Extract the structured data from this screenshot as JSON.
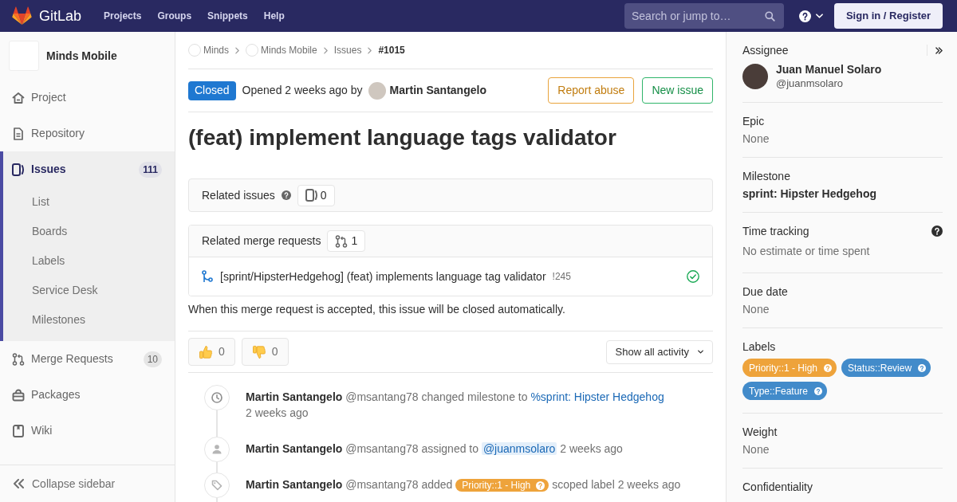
{
  "topbar": {
    "brand": "GitLab",
    "nav": [
      "Projects",
      "Groups",
      "Snippets",
      "Help"
    ],
    "search": {
      "placeholder": "Search or jump to…"
    },
    "sign_in": "Sign in / Register"
  },
  "sidebar": {
    "project": "Minds Mobile",
    "items": [
      {
        "label": "Project",
        "selected": false
      },
      {
        "label": "Repository",
        "selected": false
      },
      {
        "label": "Issues",
        "count": "111",
        "selected": true,
        "children": [
          {
            "label": "List",
            "selected": false
          },
          {
            "label": "Boards",
            "selected": false
          },
          {
            "label": "Labels",
            "selected": false
          },
          {
            "label": "Service Desk",
            "selected": false
          },
          {
            "label": "Milestones",
            "selected": false
          }
        ]
      },
      {
        "label": "Merge Requests",
        "count": "10",
        "selected": false
      },
      {
        "label": "Packages",
        "selected": false
      },
      {
        "label": "Wiki",
        "selected": false
      }
    ],
    "collapse": "Collapse sidebar"
  },
  "breadcrumbs": [
    {
      "label": "Minds",
      "kind": "avatar"
    },
    {
      "label": "Minds Mobile",
      "kind": "avatar"
    },
    {
      "label": "Issues",
      "kind": "link"
    },
    {
      "label": "#1015",
      "kind": "current"
    }
  ],
  "issue": {
    "status": {
      "label": "Closed",
      "kind": "closed"
    },
    "opened": "Opened 2 weeks ago by",
    "author": "Martin Santangelo",
    "actions": [
      {
        "label": "Report abuse",
        "kind": "warning"
      },
      {
        "label": "New issue",
        "kind": "success"
      }
    ],
    "title": "(feat) implement language tags validator"
  },
  "related_issues": {
    "title": "Related issues",
    "help": true,
    "count": "0"
  },
  "related_merge_requests": {
    "title": "Related merge requests",
    "count": "1",
    "items": [
      {
        "title": "[sprint/HipsterHedgehog] (feat) implements language tag validator",
        "ref": "!245",
        "passed": true
      }
    ]
  },
  "closing_note": "When this merge request is accepted, this issue will be closed automatically.",
  "awards": [
    {
      "kind": "thumbsup",
      "count": "0"
    },
    {
      "kind": "thumbsdown",
      "count": "0"
    }
  ],
  "activity_filter": "Show all activity",
  "timeline": [
    {
      "kind": "milestone",
      "segments": [
        {
          "kind": "author",
          "text": "Martin Santangelo"
        },
        {
          "kind": "text",
          "text": "@msantang78 changed milestone to"
        },
        {
          "kind": "link",
          "text": "%sprint: Hipster Hedgehog"
        },
        {
          "kind": "time",
          "text": "2 weeks ago"
        }
      ]
    },
    {
      "kind": "assignee",
      "segments": [
        {
          "kind": "author",
          "text": "Martin Santangelo"
        },
        {
          "kind": "text",
          "text": "@msantang78 assigned to"
        },
        {
          "kind": "mention",
          "text": "@juanmsolaro"
        },
        {
          "kind": "time",
          "text": "2 weeks ago"
        }
      ]
    },
    {
      "kind": "label",
      "segments": [
        {
          "kind": "author",
          "text": "Martin Santangelo"
        },
        {
          "kind": "text",
          "text": "@msantang78 added"
        },
        {
          "kind": "label",
          "text": "Priority::1 - High",
          "color": "#eea33b"
        },
        {
          "kind": "text",
          "text": "scoped label"
        },
        {
          "kind": "time",
          "text": "2 weeks ago"
        }
      ]
    }
  ],
  "right_sidebar": {
    "assignee": {
      "label": "Assignee",
      "name": "Juan Manuel Solaro",
      "username": "@juanmsolaro"
    },
    "sections": [
      {
        "label": "Epic",
        "value": "None",
        "kind": "muted"
      },
      {
        "label": "Milestone",
        "value": "sprint: Hipster Hedgehog",
        "kind": "strong"
      },
      {
        "label": "Time tracking",
        "value": "No estimate or time spent",
        "kind": "muted",
        "help": true
      },
      {
        "label": "Due date",
        "value": "None",
        "kind": "muted"
      },
      {
        "label": "Labels",
        "kind": "labels",
        "labels": [
          {
            "text": "Priority::1 - High",
            "color": "#eea33b"
          },
          {
            "text": "Status::Review",
            "color": "#428bca"
          },
          {
            "text": "Type::Feature",
            "color": "#428bca"
          }
        ]
      },
      {
        "label": "Weight",
        "value": "None",
        "kind": "muted"
      },
      {
        "label": "Confidentiality",
        "kind": "title"
      }
    ]
  }
}
